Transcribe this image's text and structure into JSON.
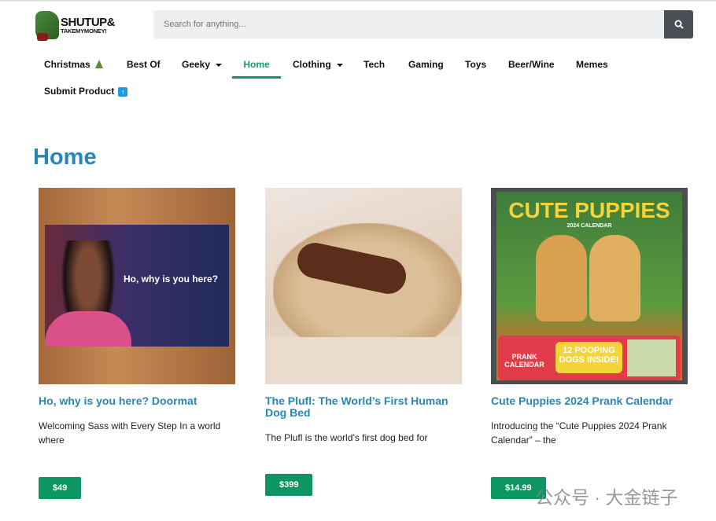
{
  "header": {
    "logo_line1": "SHUTUP&",
    "logo_line2": "TAKEMYMONEY!",
    "search_placeholder": "Search for anything..."
  },
  "nav": {
    "items": [
      {
        "label": "Christmas"
      },
      {
        "label": "Best Of"
      },
      {
        "label": "Geeky"
      },
      {
        "label": "Home"
      },
      {
        "label": "Clothing"
      },
      {
        "label": "Tech"
      },
      {
        "label": "Gaming"
      },
      {
        "label": "Toys"
      },
      {
        "label": "Beer/Wine"
      },
      {
        "label": "Memes"
      },
      {
        "label": "Submit Product"
      }
    ]
  },
  "page_title": "Home",
  "products": [
    {
      "title": "Ho, why is you here? Doormat",
      "desc": "Welcoming Sass with Every Step In a world where",
      "price": "$49",
      "image_text": "Ho, why is you here?"
    },
    {
      "title": "The Plufl: The World’s First Human Dog Bed",
      "desc": "The Plufl is the world’s first dog bed for",
      "price": "$399"
    },
    {
      "title": "Cute Puppies 2024 Prank Calendar",
      "desc": "Introducing the “Cute Puppies 2024 Prank Calendar” – the",
      "price": "$14.99",
      "image_text": "CUTE PUPPIES",
      "image_sub": "2024 CALENDAR",
      "image_badge1": "PRANK CALENDAR",
      "image_badge2": "12 POOPING DOGS INSIDE!"
    }
  ],
  "watermark": "公众号 · 大金链子",
  "colors": {
    "accent": "#2a86b6",
    "price": "#0d9563",
    "nav_active": "#10936a"
  }
}
